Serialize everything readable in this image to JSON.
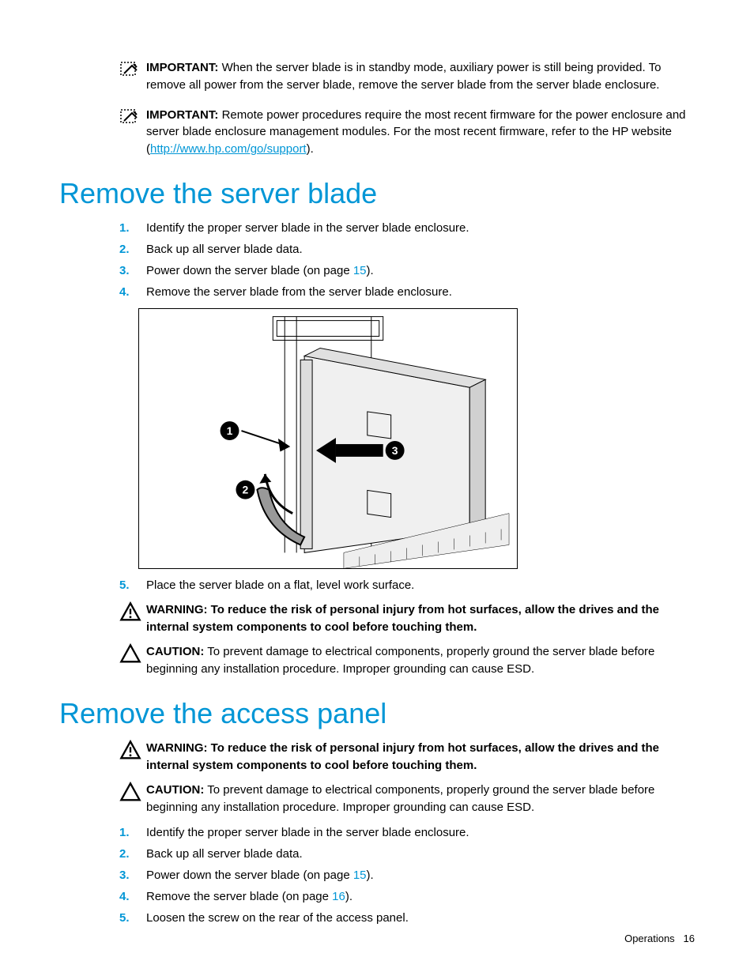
{
  "notices": {
    "important1": {
      "label": "IMPORTANT:",
      "text": "When the server blade is in standby mode, auxiliary power is still being provided. To remove all power from the server blade, remove the server blade from the server blade enclosure."
    },
    "important2": {
      "label": "IMPORTANT:",
      "text_before_link": "Remote power procedures require the most recent firmware for the power enclosure and server blade enclosure management modules. For the most recent firmware, refer to the HP website (",
      "link": "http://www.hp.com/go/support",
      "text_after_link": ")."
    }
  },
  "section1": {
    "heading": "Remove the server blade",
    "steps": {
      "s1": "Identify the proper server blade in the server blade enclosure.",
      "s2": "Back up all server blade data.",
      "s3_before": "Power down the server blade (on page ",
      "s3_ref": "15",
      "s3_after": ").",
      "s4": "Remove the server blade from the server blade enclosure.",
      "s5": "Place the server blade on a flat, level work surface."
    },
    "warning": {
      "label": "WARNING:",
      "text": "To reduce the risk of personal injury from hot surfaces, allow the drives and the internal system components to cool before touching them."
    },
    "caution": {
      "label": "CAUTION:",
      "text": "To prevent damage to electrical components, properly ground the server blade before beginning any installation procedure. Improper grounding can cause ESD."
    }
  },
  "section2": {
    "heading": "Remove the access panel",
    "warning": {
      "label": "WARNING:",
      "text": "To reduce the risk of personal injury from hot surfaces, allow the drives and the internal system components to cool before touching them."
    },
    "caution": {
      "label": "CAUTION:",
      "text": "To prevent damage to electrical components, properly ground the server blade before beginning any installation procedure. Improper grounding can cause ESD."
    },
    "steps": {
      "s1": "Identify the proper server blade in the server blade enclosure.",
      "s2": "Back up all server blade data.",
      "s3_before": "Power down the server blade (on page ",
      "s3_ref": "15",
      "s3_after": ").",
      "s4_before": "Remove the server blade (on page ",
      "s4_ref": "16",
      "s4_after": ").",
      "s5": "Loosen the screw on the rear of the access panel."
    }
  },
  "footer": {
    "section": "Operations",
    "page": "16"
  }
}
